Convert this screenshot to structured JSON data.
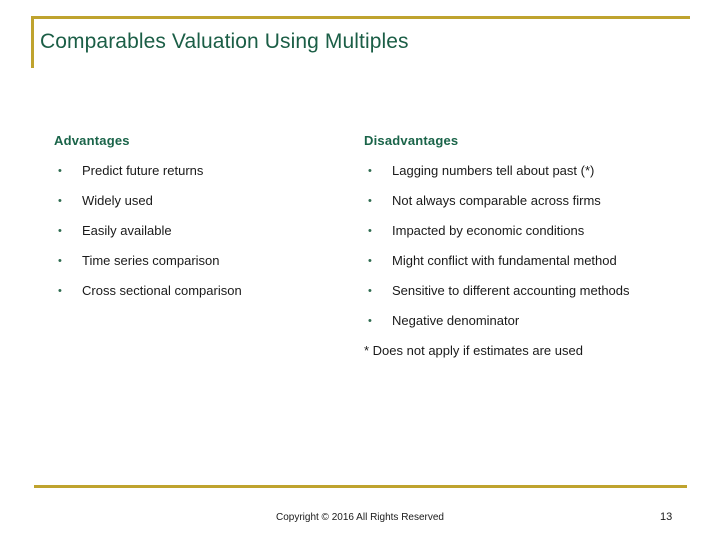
{
  "slide": {
    "title": "Comparables Valuation Using Multiples",
    "accent_color": "#bfa32e",
    "title_color": "#1b5e46",
    "header_color": "#1a6449",
    "body_color": "#1a1a1a",
    "background_color": "#ffffff"
  },
  "columns": {
    "left": {
      "header": "Advantages",
      "bullets": [
        "Predict future returns",
        "Widely used",
        "Easily available",
        "Time series comparison",
        "Cross sectional comparison"
      ]
    },
    "right": {
      "header": "Disadvantages",
      "bullets": [
        "Lagging numbers tell about past (*)",
        "Not always comparable across firms",
        "Impacted by economic conditions",
        "Might conflict with fundamental method",
        "Sensitive to different accounting methods",
        "Negative denominator"
      ],
      "footnote": "* Does not apply if estimates are used"
    }
  },
  "bullet_glyph": "•",
  "footer": {
    "copyright": "Copyright © 2016 All Rights Reserved",
    "page_number": "13"
  }
}
